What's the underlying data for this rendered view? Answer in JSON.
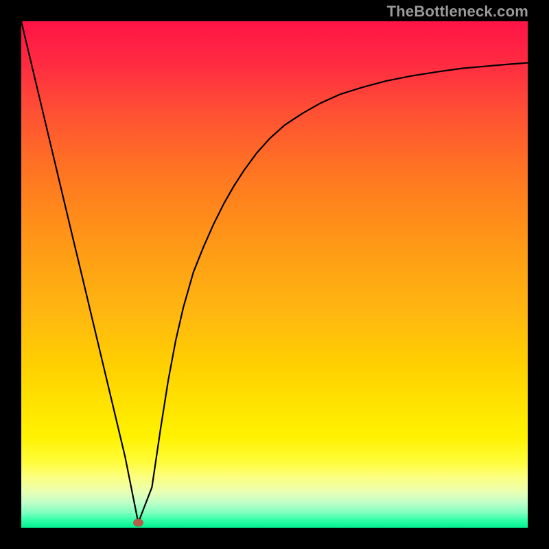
{
  "watermark": "TheBottleneck.com",
  "marker": {
    "x_frac": 0.231,
    "y_frac": 0.99,
    "rx": 7,
    "ry": 5.5
  },
  "chart_data": {
    "type": "line",
    "title": "",
    "xlabel": "",
    "ylabel": "",
    "xlim": [
      0,
      1
    ],
    "ylim": [
      0,
      1
    ],
    "series": [
      {
        "name": "bottleneck-curve",
        "x": [
          0.0,
          0.02,
          0.04,
          0.06,
          0.08,
          0.1,
          0.12,
          0.14,
          0.16,
          0.18,
          0.205,
          0.231,
          0.258,
          0.275,
          0.29,
          0.305,
          0.32,
          0.34,
          0.36,
          0.38,
          0.4,
          0.42,
          0.44,
          0.465,
          0.49,
          0.52,
          0.555,
          0.59,
          0.63,
          0.675,
          0.72,
          0.77,
          0.82,
          0.87,
          0.915,
          0.96,
          1.0
        ],
        "values": [
          1.0,
          0.916,
          0.832,
          0.748,
          0.664,
          0.58,
          0.497,
          0.413,
          0.329,
          0.245,
          0.14,
          0.01,
          0.08,
          0.195,
          0.29,
          0.37,
          0.435,
          0.505,
          0.555,
          0.6,
          0.64,
          0.675,
          0.706,
          0.74,
          0.768,
          0.795,
          0.818,
          0.838,
          0.856,
          0.87,
          0.882,
          0.892,
          0.9,
          0.907,
          0.911,
          0.915,
          0.918
        ]
      }
    ],
    "gradient_stops": [
      {
        "pos": 0.0,
        "color": "#00f090"
      },
      {
        "pos": 0.015,
        "color": "#30ffa8"
      },
      {
        "pos": 0.03,
        "color": "#80ffc0"
      },
      {
        "pos": 0.05,
        "color": "#c0ffc8"
      },
      {
        "pos": 0.07,
        "color": "#e8ffb4"
      },
      {
        "pos": 0.1,
        "color": "#fcff80"
      },
      {
        "pos": 0.13,
        "color": "#fffc3a"
      },
      {
        "pos": 0.18,
        "color": "#fff200"
      },
      {
        "pos": 0.24,
        "color": "#ffe400"
      },
      {
        "pos": 0.32,
        "color": "#ffd000"
      },
      {
        "pos": 0.42,
        "color": "#ffb810"
      },
      {
        "pos": 0.52,
        "color": "#ffa214"
      },
      {
        "pos": 0.62,
        "color": "#ff8a1a"
      },
      {
        "pos": 0.72,
        "color": "#ff7024"
      },
      {
        "pos": 0.82,
        "color": "#ff5034"
      },
      {
        "pos": 0.92,
        "color": "#ff2a42"
      },
      {
        "pos": 1.0,
        "color": "#ff1446"
      }
    ]
  }
}
